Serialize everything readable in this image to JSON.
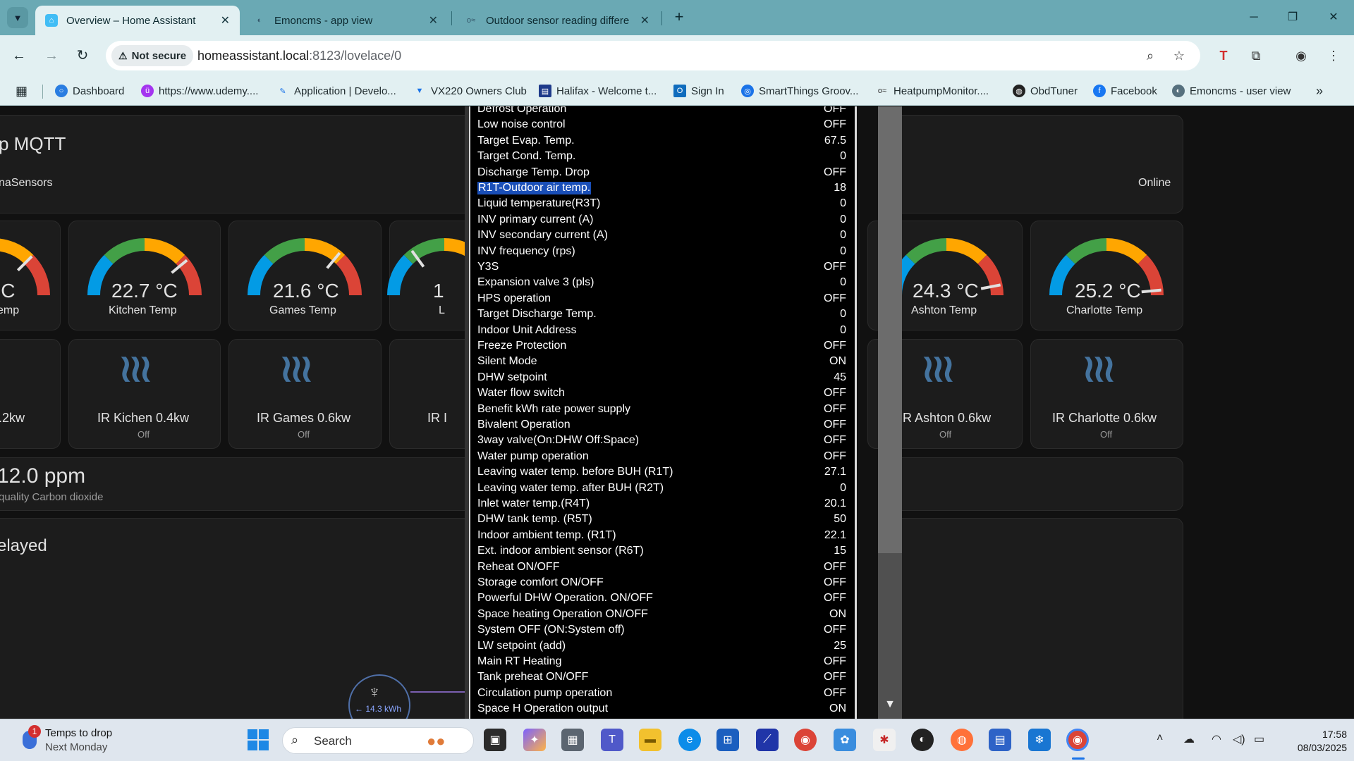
{
  "browser": {
    "tabs": [
      {
        "title": "Overview – Home Assistant",
        "active": true
      },
      {
        "title": "Emoncms - app view",
        "active": false
      },
      {
        "title": "Outdoor sensor reading differe",
        "active": false
      }
    ],
    "security_label": "Not secure",
    "url_host": "homeassistant.local",
    "url_rest": ":8123/lovelace/0",
    "bookmarks": [
      "Dashboard",
      "https://www.udemy....",
      "Application | Develo...",
      "VX220 Owners Club",
      "Halifax - Welcome t...",
      "Sign In",
      "SmartThings Groov...",
      "HeatpumpMonitor....",
      "ObdTuner",
      "Facebook",
      "Emoncms - user view"
    ]
  },
  "dashboard": {
    "header_title": "p MQTT",
    "header_sub": "naSensors",
    "header_status": "Online",
    "gauges": [
      {
        "value": "°C",
        "name": "emp"
      },
      {
        "value": "22.7 °C",
        "name": "Kitchen Temp"
      },
      {
        "value": "21.6 °C",
        "name": "Games Temp"
      },
      {
        "value": "1",
        "name": "L"
      },
      {
        "value": "24.3 °C",
        "name": "Ashton Temp"
      },
      {
        "value": "25.2 °C",
        "name": "Charlotte Temp"
      }
    ],
    "heaters": [
      {
        "name": ".2kw",
        "state": ""
      },
      {
        "name": "IR Kichen 0.4kw",
        "state": "Off"
      },
      {
        "name": "IR Games 0.6kw",
        "state": "Off"
      },
      {
        "name": "IR I",
        "state": ""
      },
      {
        "name": "R Ashton 0.6kw",
        "state": "Off"
      },
      {
        "name": "IR Charlotte 0.6kw",
        "state": "Off"
      }
    ],
    "co2_value": "12.0 ppm",
    "co2_label": "quality Carbon dioxide",
    "delayed_label": "elayed",
    "energy_value": "← 14.3 kWh"
  },
  "popup": {
    "rows": [
      {
        "label": "Defrost Operation",
        "value": "OFF"
      },
      {
        "label": "Low noise control",
        "value": "OFF"
      },
      {
        "label": "Target Evap. Temp.",
        "value": "67.5"
      },
      {
        "label": "Target Cond. Temp.",
        "value": "0"
      },
      {
        "label": "Discharge Temp. Drop",
        "value": "OFF"
      },
      {
        "label": "R1T-Outdoor air temp.",
        "value": "18",
        "selected": true
      },
      {
        "label": "Liquid temperature(R3T)",
        "value": "0"
      },
      {
        "label": "INV primary current (A)",
        "value": "0"
      },
      {
        "label": "INV secondary current (A)",
        "value": "0"
      },
      {
        "label": "INV frequency (rps)",
        "value": "0"
      },
      {
        "label": "Y3S",
        "value": "OFF"
      },
      {
        "label": "Expansion valve 3 (pls)",
        "value": "0"
      },
      {
        "label": "HPS operation",
        "value": "OFF"
      },
      {
        "label": "Target Discharge Temp.",
        "value": "0"
      },
      {
        "label": "Indoor Unit Address",
        "value": "0"
      },
      {
        "label": "Freeze Protection",
        "value": "OFF"
      },
      {
        "label": "Silent Mode",
        "value": "ON"
      },
      {
        "label": "DHW setpoint",
        "value": "45"
      },
      {
        "label": "Water flow switch",
        "value": "OFF"
      },
      {
        "label": "Benefit kWh rate power supply",
        "value": "OFF"
      },
      {
        "label": "Bivalent Operation",
        "value": "OFF"
      },
      {
        "label": "3way valve(On:DHW Off:Space)",
        "value": "OFF"
      },
      {
        "label": "Water pump operation",
        "value": "OFF"
      },
      {
        "label": "Leaving water temp. before BUH (R1T)",
        "value": "27.1"
      },
      {
        "label": "Leaving water temp. after BUH (R2T)",
        "value": "0"
      },
      {
        "label": "Inlet water temp.(R4T)",
        "value": "20.1"
      },
      {
        "label": "DHW tank temp. (R5T)",
        "value": "50"
      },
      {
        "label": "Indoor ambient temp. (R1T)",
        "value": "22.1"
      },
      {
        "label": "Ext. indoor ambient sensor (R6T)",
        "value": "15"
      },
      {
        "label": "Reheat ON/OFF",
        "value": "OFF"
      },
      {
        "label": "Storage comfort ON/OFF",
        "value": "OFF"
      },
      {
        "label": "Powerful DHW Operation. ON/OFF",
        "value": "OFF"
      },
      {
        "label": "Space heating Operation ON/OFF",
        "value": "ON"
      },
      {
        "label": "System OFF (ON:System off)",
        "value": "OFF"
      },
      {
        "label": "LW setpoint (add)",
        "value": "25"
      },
      {
        "label": "Main RT Heating",
        "value": "OFF"
      },
      {
        "label": "Tank preheat ON/OFF",
        "value": "OFF"
      },
      {
        "label": "Circulation pump operation",
        "value": "OFF"
      },
      {
        "label": "Space H Operation output",
        "value": "ON"
      }
    ]
  },
  "taskbar": {
    "notif_count": "1",
    "weather_title": "Temps to drop",
    "weather_sub": "Next Monday",
    "search_placeholder": "Search",
    "time": "17:58",
    "date": "08/03/2025"
  },
  "colors": {
    "gauge_blue": "#039be5",
    "gauge_green": "#43a047",
    "gauge_yellow": "#ffa600",
    "gauge_red": "#db4437",
    "heater_icon": "#44739e",
    "selection": "#1a4fb8"
  }
}
